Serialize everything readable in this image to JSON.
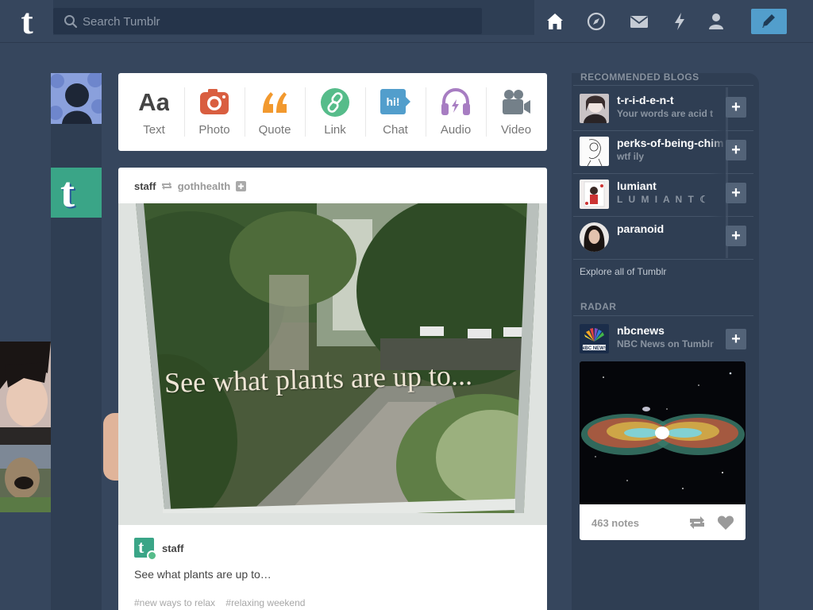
{
  "header": {
    "logo_letter": "t",
    "search_placeholder": "Search Tumblr",
    "nav_icons": [
      "home-icon",
      "explore-compass-icon",
      "inbox-mail-icon",
      "activity-lightning-icon",
      "account-person-icon",
      "compose-pencil-icon"
    ]
  },
  "composer": {
    "types": [
      {
        "label": "Text",
        "icon_text": "Aa",
        "color": "#444444"
      },
      {
        "label": "Photo",
        "color": "#d95e40"
      },
      {
        "label": "Quote",
        "icon_text": "“",
        "color": "#f2992e"
      },
      {
        "label": "Link",
        "color": "#56bc8a"
      },
      {
        "label": "Chat",
        "icon_text": "hi!",
        "color": "#529ecc"
      },
      {
        "label": "Audio",
        "color": "#a77dc2"
      },
      {
        "label": "Video",
        "color": "#748089"
      }
    ]
  },
  "post": {
    "author": "staff",
    "reblogged_from": "gothhealth",
    "image_caption": "See what plants are up to...",
    "footer_author": "staff",
    "body": "See what plants are up to…",
    "tags": [
      "#new ways to relax",
      "#relaxing weekend"
    ]
  },
  "sidebar": {
    "recommended_heading": "RECOMMENDED BLOGS",
    "recommended": [
      {
        "name": "t-r-i-d-e-n-t",
        "desc": "Your words are acid t"
      },
      {
        "name": "perks-of-being-chim",
        "desc": "wtf ily"
      },
      {
        "name": "lumiant",
        "desc": "L U M I A N T ☾"
      },
      {
        "name": "paranoid",
        "desc": ""
      }
    ],
    "follow_label": "+",
    "explore_link": "Explore all of Tumblr",
    "radar_heading": "RADAR",
    "radar": {
      "name": "nbcnews",
      "desc": "NBC News on Tumblr",
      "notes": "463 notes"
    }
  },
  "colors": {
    "background": "#36465d",
    "accent": "#529ecc"
  }
}
